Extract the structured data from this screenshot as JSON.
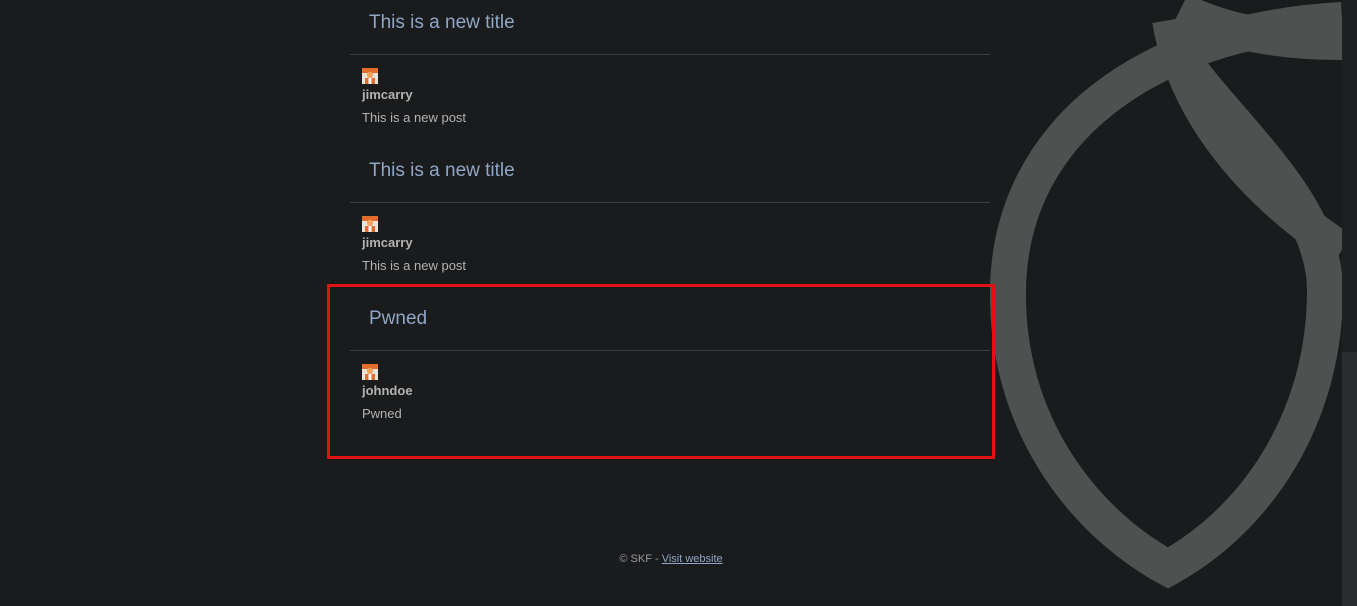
{
  "posts": [
    {
      "title": "This is a new title",
      "author": "jimcarry",
      "body": "This is a new post"
    },
    {
      "title": "This is a new title",
      "author": "jimcarry",
      "body": "This is a new post"
    },
    {
      "title": "Pwned",
      "author": "johndoe",
      "body": "Pwned"
    }
  ],
  "footer": {
    "copyright": "© SKF -",
    "link_label": "Visit website"
  },
  "colors": {
    "background": "#1a1b1d",
    "title": "#8fa6c4",
    "text": "#b3b3b3",
    "logo": "#4e5150",
    "highlight": "#e21212"
  },
  "icons": {
    "avatar": "user-avatar-icon",
    "background_logo": "shield-leaf-logo"
  }
}
